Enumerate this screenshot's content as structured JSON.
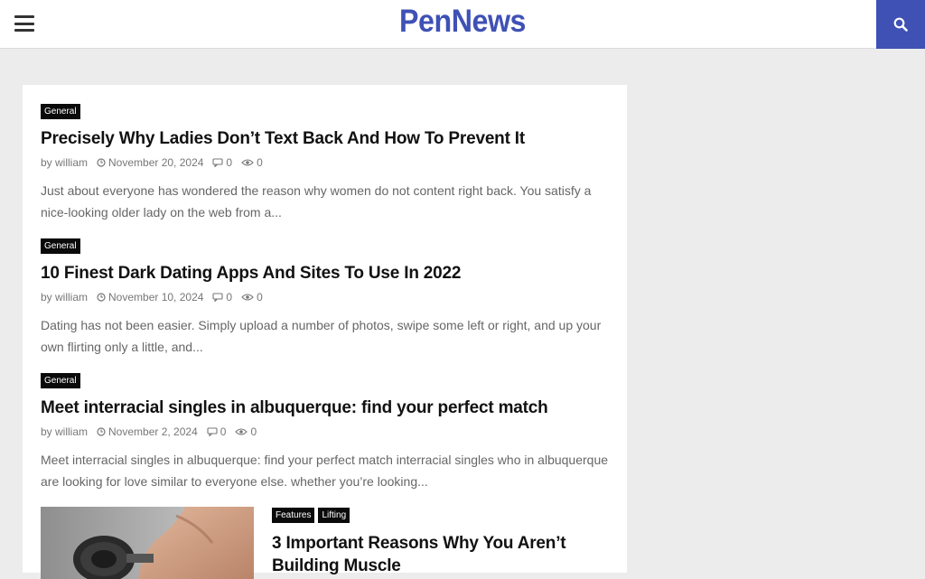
{
  "header": {
    "logo": "PenNews",
    "brand_color": "#3f51b5",
    "menu_icon": "hamburger-menu-icon",
    "search_icon": "search-icon"
  },
  "posts": [
    {
      "category": "General",
      "title": "Precisely Why Ladies Don’t Text Back And How To Prevent It",
      "author": "by william",
      "date": "November 20, 2024",
      "comments": "0",
      "views": "0",
      "excerpt": "Just about everyone has wondered the reason why women do not content right back. You satisfy a nice-looking older lady on the web from a..."
    },
    {
      "category": "General",
      "title": "10 Finest Dark Dating Apps And Sites To Use In 2022",
      "author": "by william",
      "date": "November 10, 2024",
      "comments": "0",
      "views": "0",
      "excerpt": "Dating has not been easier. Simply upload a number of photos, swipe some left or right, and up your own flirting only a little, and..."
    },
    {
      "category": "General",
      "title": "Meet interracial singles in albuquerque: find your perfect match",
      "author": "by william",
      "date": "November 2, 2024",
      "comments": "0",
      "views": "0",
      "excerpt": "Meet interracial singles in albuquerque: find your perfect match interracial singles who in albuquerque are looking for love similar to everyone else. whether you’re looking..."
    }
  ],
  "featured_post": {
    "categories": [
      "Features",
      "Lifting"
    ],
    "title_line1": "3 Important Reasons Why You Aren’t",
    "title_line2": "Building Muscle"
  }
}
